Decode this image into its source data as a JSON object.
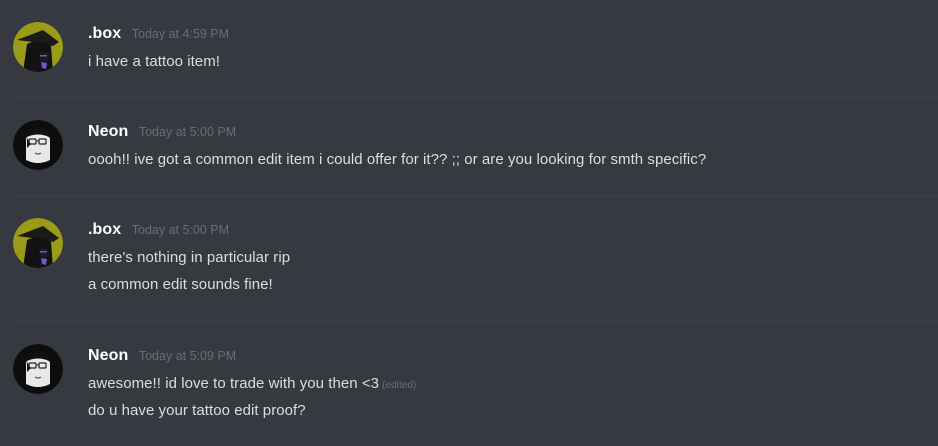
{
  "messages": [
    {
      "username": ".box",
      "timestamp": "Today at 4:59 PM",
      "avatar": "box-avatar",
      "lines": [
        "i have a tattoo item!"
      ]
    },
    {
      "username": "Neon",
      "timestamp": "Today at 5:00 PM",
      "avatar": "neon-avatar",
      "lines": [
        "oooh!! ive got a common edit item i could offer for it?? ;; or are you looking for smth specific?"
      ]
    },
    {
      "username": ".box",
      "timestamp": "Today at 5:00 PM",
      "avatar": "box-avatar",
      "lines": [
        "there's nothing in particular rip",
        "a common edit sounds fine!"
      ]
    },
    {
      "username": "Neon",
      "timestamp": "Today at 5:09 PM",
      "avatar": "neon-avatar",
      "lines": [
        "awesome!! id love to trade with you then <3",
        "do u have your tattoo edit proof?"
      ],
      "edited_label": "(edited)"
    }
  ],
  "colors": {
    "background": "#36393f",
    "username": "#ffffff",
    "message_text": "#dcddde",
    "timestamp": "#6a6d73",
    "divider": "#3f4248",
    "box_avatar_bg": "#9b9b1a"
  }
}
